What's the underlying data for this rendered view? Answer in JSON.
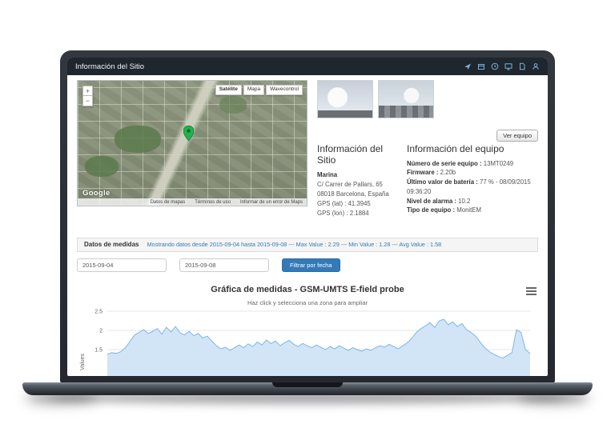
{
  "titlebar": {
    "title": "Información del Sitio",
    "icons": [
      "send",
      "calendar",
      "clock",
      "display",
      "document",
      "user"
    ]
  },
  "map": {
    "zoom_in": "+",
    "zoom_out": "−",
    "controls": [
      "Satélite",
      "Mapa",
      "Wavecontrol"
    ],
    "google": "Google",
    "attribution": [
      "Datos de mapas",
      "Términos de uso",
      "Informar de un error de Maps"
    ]
  },
  "site": {
    "title": "Información del Sitio",
    "name": "Marina",
    "address1": "C/ Carrer de Pallars, 65",
    "address2": "08018 Barcelona, España",
    "gps_lat": "GPS (lat) : 41.3945",
    "gps_lon": "GPS (lon) : 2.1884"
  },
  "equipment": {
    "title": "Información del equipo",
    "view_button": "Ver equipo",
    "rows": [
      {
        "label": "Número de serie equipo :",
        "value": "13MT0249"
      },
      {
        "label": "Firmware :",
        "value": "2.20b"
      },
      {
        "label": "Último valor de batería :",
        "value": "77 % - 08/09/2015 09:36:20"
      },
      {
        "label": "Nivel de alarma :",
        "value": "10.2"
      },
      {
        "label": "Tipo de equipo :",
        "value": "MonitEM"
      }
    ]
  },
  "measurements": {
    "header": "Datos de medidas",
    "summary": "Mostrando datos desde 2015-09-04 hasta 2015-09-08 --- Max Value : 2.29 --- Min Value : 1.28 --- Avg Value : 1.58",
    "date_from": "2015-09-04",
    "date_to": "2015-09-08",
    "filter_button": "Filtrar por fecha"
  },
  "chart_data": {
    "type": "area",
    "title": "Gráfica de medidas - GSM-UMTS E-field probe",
    "subtitle": "Haz click y selecciona una zona para ampliar",
    "ylabel": "Values",
    "yticks": [
      1.5,
      2,
      2.5
    ],
    "ylim_visible": [
      1.1,
      2.6
    ],
    "x_range": [
      "2015-09-04",
      "2015-09-08"
    ],
    "max_value": 2.29,
    "min_value": 1.28,
    "avg_value": 1.58,
    "line_color": "#7cb5ec",
    "fill_color": "#d2e5f6",
    "values": [
      1.38,
      1.42,
      1.4,
      1.45,
      1.55,
      1.72,
      1.88,
      1.95,
      2.02,
      1.92,
      1.98,
      2.05,
      1.9,
      2.08,
      1.96,
      2.1,
      1.94,
      1.88,
      1.98,
      1.86,
      1.92,
      1.8,
      1.85,
      1.72,
      1.6,
      1.52,
      1.56,
      1.48,
      1.55,
      1.62,
      1.55,
      1.65,
      1.58,
      1.7,
      1.62,
      1.75,
      1.66,
      1.72,
      1.6,
      1.68,
      1.74,
      1.64,
      1.58,
      1.66,
      1.6,
      1.55,
      1.62,
      1.56,
      1.5,
      1.58,
      1.52,
      1.6,
      1.54,
      1.48,
      1.55,
      1.5,
      1.46,
      1.52,
      1.48,
      1.55,
      1.6,
      1.56,
      1.64,
      1.58,
      1.52,
      1.6,
      1.68,
      1.8,
      1.95,
      2.05,
      2.12,
      2.2,
      2.08,
      2.25,
      2.29,
      2.15,
      2.22,
      2.1,
      2.18,
      2.02,
      1.95,
      1.85,
      1.7,
      1.55,
      1.45,
      1.38,
      1.32,
      1.28,
      1.35,
      1.42,
      2.02,
      1.95,
      1.5,
      1.4
    ]
  }
}
